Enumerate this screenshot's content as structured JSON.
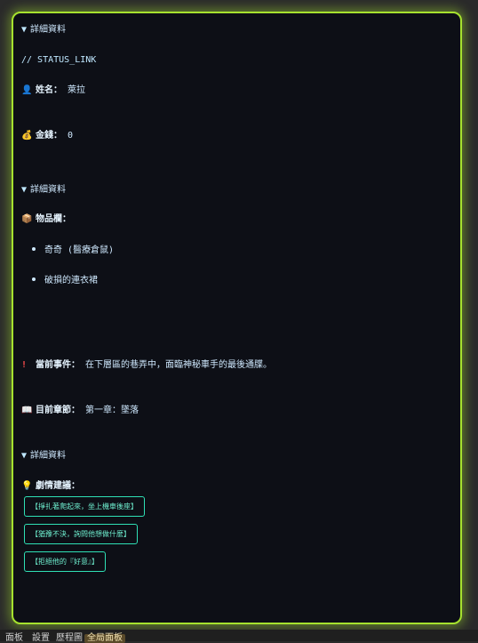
{
  "panel": {
    "details_1": "詳細資料",
    "status_link": "// STATUS_LINK",
    "name_label": "姓名：",
    "name_value": "萊拉",
    "money_label": "金錢：",
    "money_value": "0",
    "details_2": "詳細資料",
    "inventory_label": "物品欄：",
    "inventory_items": [
      "奇奇 (醫療倉鼠)",
      "破損的連衣裙"
    ],
    "event_label": "當前事件：",
    "event_value": "在下層區的巷弄中，面臨神秘車手的最後通牒。",
    "chapter_label": "目前章節：",
    "chapter_value": "第一章：墜落",
    "details_3": "詳細資料",
    "suggest_label": "劇情建議：",
    "choices": [
      "【掙扎著爬起來，坐上機車後座】",
      "【猶豫不決，詢問他想做什麼】",
      "【拒絕他的『好意』】"
    ]
  },
  "bottom": {
    "tabs": [
      "面板",
      "設置",
      "歷程圖",
      "全局面板"
    ]
  },
  "icons": {
    "name": "person-icon",
    "money": "money-bag-icon",
    "inventory": "package-icon",
    "event": "exclamation-icon",
    "chapter": "book-icon",
    "suggest": "lightbulb-icon"
  },
  "colors": {
    "border": "#a6e22e",
    "panel_bg": "#0d0f16",
    "choice_border": "#2fe0b5"
  }
}
